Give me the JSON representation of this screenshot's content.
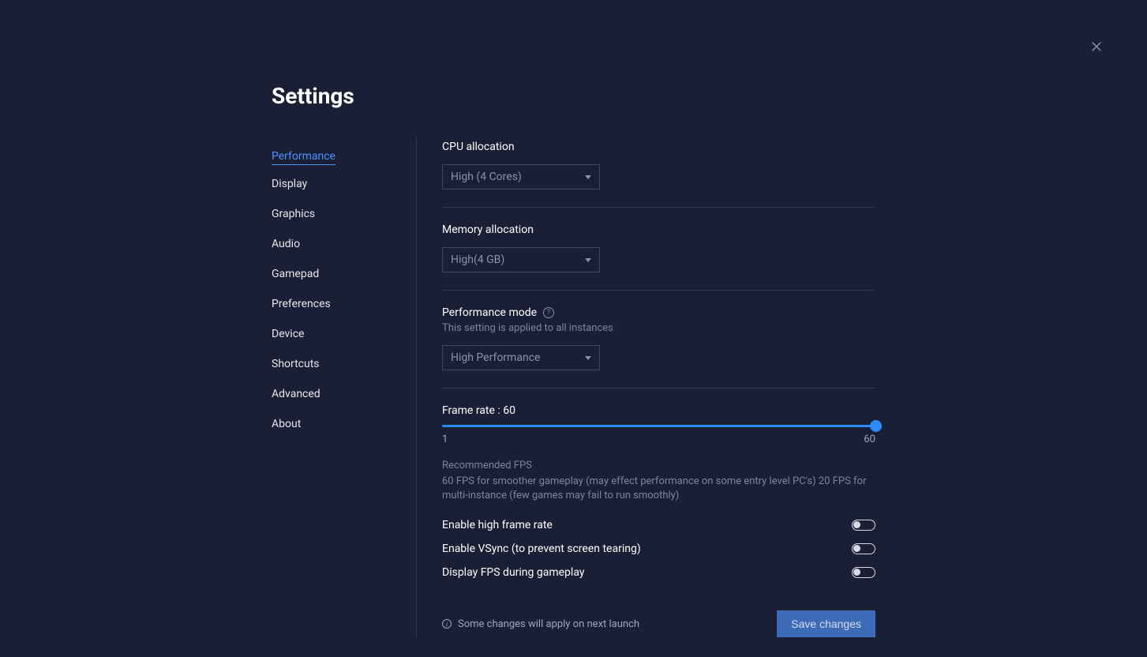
{
  "title": "Settings",
  "sidebar": {
    "items": [
      {
        "label": "Performance",
        "active": true
      },
      {
        "label": "Display"
      },
      {
        "label": "Graphics"
      },
      {
        "label": "Audio"
      },
      {
        "label": "Gamepad"
      },
      {
        "label": "Preferences"
      },
      {
        "label": "Device"
      },
      {
        "label": "Shortcuts"
      },
      {
        "label": "Advanced"
      },
      {
        "label": "About"
      }
    ]
  },
  "cpu": {
    "label": "CPU allocation",
    "value": "High (4 Cores)"
  },
  "memory": {
    "label": "Memory allocation",
    "value": "High(4 GB)"
  },
  "perfmode": {
    "label": "Performance mode",
    "sublabel": "This setting is applied to all instances",
    "value": "High Performance"
  },
  "framerate": {
    "label": "Frame rate : 60",
    "min": "1",
    "max": "60",
    "current": 60
  },
  "fps_hint": {
    "head": "Recommended FPS",
    "body": "60 FPS for smoother gameplay (may effect performance on some entry level PC's) 20 FPS for multi-instance (few games may fail to run smoothly)"
  },
  "toggles": {
    "high_frame": {
      "label": "Enable high frame rate",
      "on": false
    },
    "vsync": {
      "label": "Enable VSync (to prevent screen tearing)",
      "on": false
    },
    "display_fps": {
      "label": "Display FPS during gameplay",
      "on": false
    }
  },
  "footer": {
    "note": "Some changes will apply on next launch",
    "save": "Save changes"
  }
}
